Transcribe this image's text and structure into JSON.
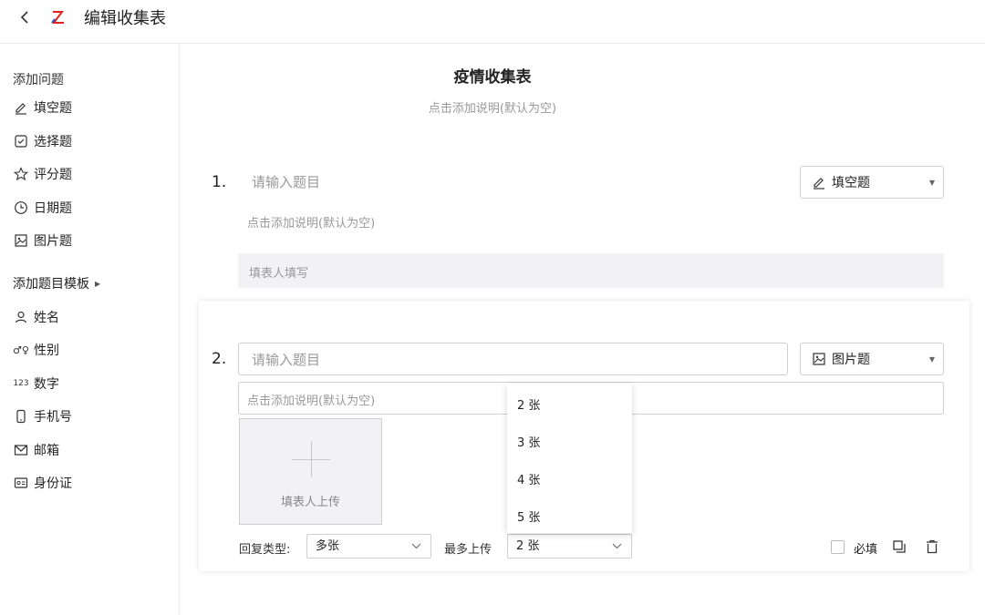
{
  "header": {
    "back_glyph": "‹",
    "title": "编辑收集表",
    "logo_color": "#e2231a"
  },
  "sidebar": {
    "add_question": "添加问题",
    "question_types": [
      {
        "label": "填空题",
        "icon": "pencil-icon"
      },
      {
        "label": "选择题",
        "icon": "checkbox-icon"
      },
      {
        "label": "评分题",
        "icon": "star-icon"
      },
      {
        "label": "日期题",
        "icon": "clock-icon"
      },
      {
        "label": "图片题",
        "icon": "image-icon"
      }
    ],
    "template_section": "添加题目模板",
    "templates": [
      {
        "label": "姓名",
        "icon": "person-icon"
      },
      {
        "label": "性别",
        "icon": "gender-icon"
      },
      {
        "label": "数字",
        "icon": "number-icon",
        "glyph": "123"
      },
      {
        "label": "手机号",
        "icon": "phone-icon"
      },
      {
        "label": "邮箱",
        "icon": "mail-icon"
      },
      {
        "label": "身份证",
        "icon": "id-card-icon"
      }
    ]
  },
  "form": {
    "title": "疫情收集表",
    "description_placeholder": "点击添加说明(默认为空)"
  },
  "questions": [
    {
      "number": "1.",
      "title_placeholder": "请输入题目",
      "description_placeholder": "点击添加说明(默认为空)",
      "type": "填空题",
      "answer_placeholder": "填表人填写"
    },
    {
      "number": "2.",
      "title_placeholder": "请输入题目",
      "description_placeholder": "点击添加说明(默认为空)",
      "type": "图片题",
      "upload_label": "填表人上传",
      "reply_type_label": "回复类型:",
      "reply_type_value": "多张",
      "max_upload_label": "最多上传",
      "max_upload_value": "2 张",
      "max_upload_options": [
        "2 张",
        "3 张",
        "4 张",
        "5 张"
      ],
      "required_label": "必填"
    }
  ]
}
